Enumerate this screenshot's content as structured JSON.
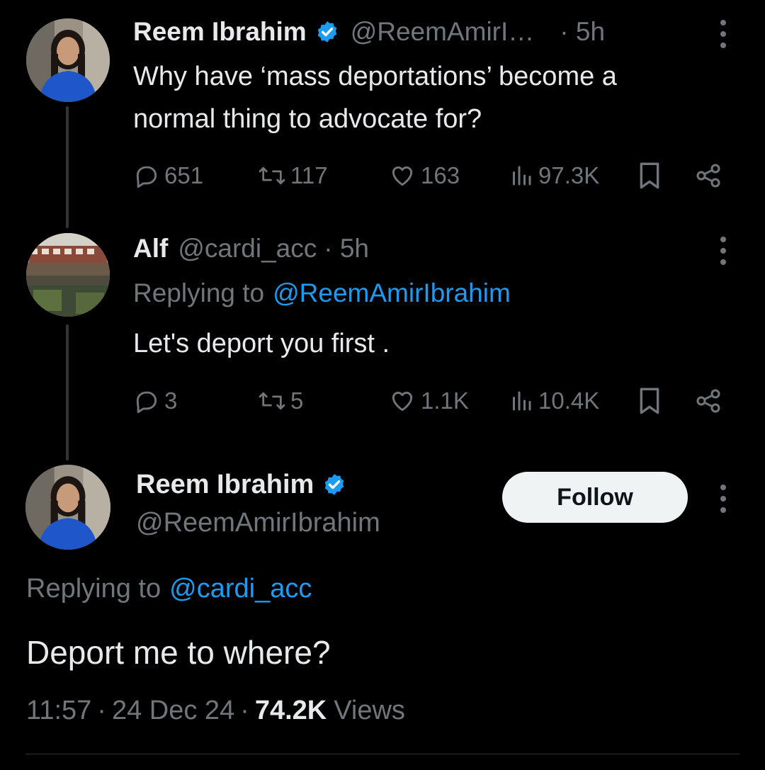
{
  "tweet1": {
    "display_name": "Reem Ibrahim",
    "handle": "@ReemAmirI…",
    "time": "· 5h",
    "text_line1": "Why have ‘mass deportations’ become a",
    "text_line2": "normal thing to advocate for?",
    "replies": "651",
    "retweets": "117",
    "likes": "163",
    "views": "97.3K"
  },
  "tweet2": {
    "display_name": "Alf",
    "handle": "@cardi_acc",
    "time": "· 5h",
    "replying_prefix": "Replying to",
    "replying_handle": "@ReemAmirIbrahim",
    "text": "Let's deport you first .",
    "replies": "3",
    "retweets": "5",
    "likes": "1.1K",
    "views": "10.4K"
  },
  "tweet3": {
    "display_name": "Reem Ibrahim",
    "handle": "@ReemAmirIbrahim",
    "follow_label": "Follow",
    "replying_prefix": "Replying to",
    "replying_handle": "@cardi_acc",
    "text": "Deport me to where?",
    "time": "11:57",
    "date": "24 Dec 24",
    "views_count": "74.2K",
    "views_label": "Views",
    "sep": "·"
  },
  "colors": {
    "background": "#000000",
    "text": "#e7e9ea",
    "muted": "#71767b",
    "link": "#1d9bf0",
    "verified": "#1d9bf0"
  },
  "icons": [
    "reply-icon",
    "retweet-icon",
    "like-icon",
    "views-icon",
    "bookmark-icon",
    "share-icon",
    "verified-badge-icon",
    "more-icon"
  ]
}
